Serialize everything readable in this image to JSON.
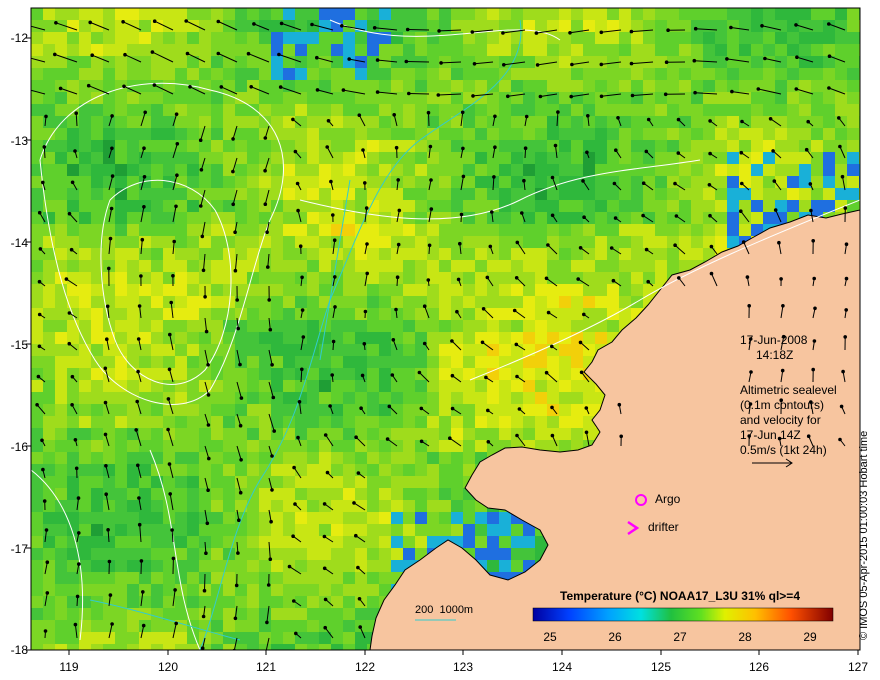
{
  "map": {
    "lon_labels": [
      "119",
      "120",
      "121",
      "122",
      "123",
      "124",
      "125",
      "126",
      "127"
    ],
    "lat_labels": [
      "-12",
      "-13",
      "-14",
      "-15",
      "-16",
      "-17",
      "-18"
    ],
    "lon_range": [
      118.6,
      127
    ],
    "lat_range": [
      -18,
      -11.7
    ],
    "colors": {
      "land": "#f7c59f",
      "frame": "#000000",
      "contour": "#ffffff",
      "bathy": "#33cccc",
      "marker": "#ff00ff"
    }
  },
  "info": {
    "date": "17-Jun-2008",
    "time": "14:18Z",
    "description": "Altimetric sealevel\n(0.1m contours)\nand velocity for\n17-Jun 14Z\n0.5m/s (1kt 24h)"
  },
  "legend": {
    "argo": "Argo",
    "drifter": "drifter",
    "bathy_label": "200  1000m"
  },
  "colorbar": {
    "title": "Temperature (°C) NOAA17_L3U 31% ql>=4",
    "ticks": [
      "25",
      "26",
      "27",
      "28",
      "29"
    ]
  },
  "credit": "© IMOS 05-Apr-2015 01:00:03 Hobart time"
}
